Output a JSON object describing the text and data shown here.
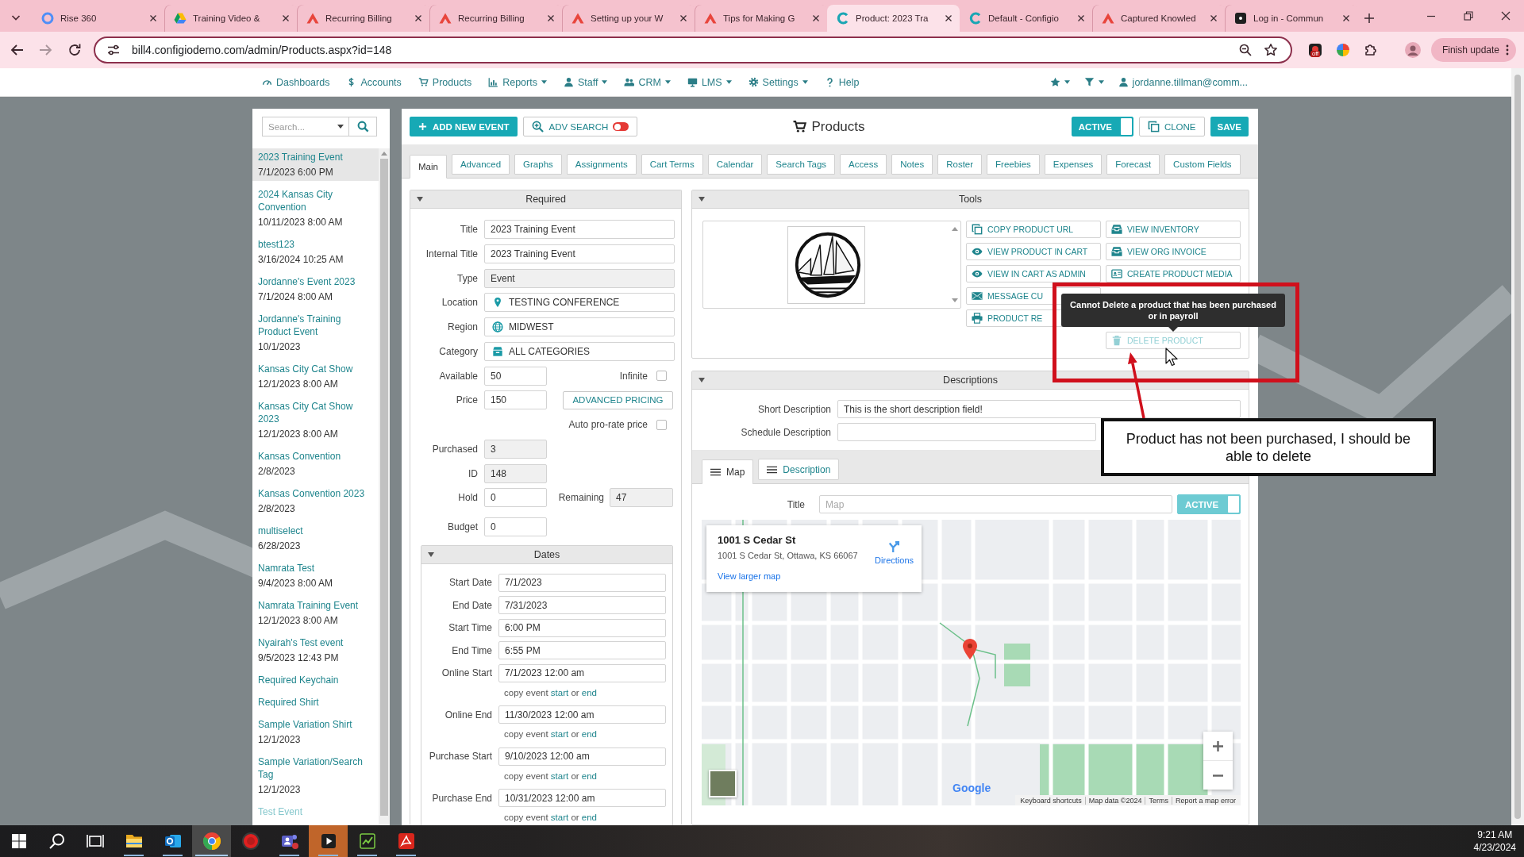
{
  "browser": {
    "tabs": [
      {
        "title": "Rise 360",
        "selected": false
      },
      {
        "title": "Training Video &",
        "selected": false
      },
      {
        "title": "Recurring Billing",
        "selected": false
      },
      {
        "title": "Recurring Billing",
        "selected": false
      },
      {
        "title": "Setting up your W",
        "selected": false
      },
      {
        "title": "Tips for Making G",
        "selected": false
      },
      {
        "title": "Product: 2023 Tra",
        "selected": true
      },
      {
        "title": "Default - Configio",
        "selected": false
      },
      {
        "title": "Captured Knowled",
        "selected": false
      },
      {
        "title": "Log in - Commun",
        "selected": false
      }
    ],
    "url": "bill4.configiodemo.com/admin/Products.aspx?id=148",
    "extension_badge": "off",
    "update_button": "Finish update"
  },
  "nav": {
    "items": [
      {
        "label": "Dashboards",
        "dropdown": false
      },
      {
        "label": "Accounts",
        "dropdown": false
      },
      {
        "label": "Products",
        "dropdown": false
      },
      {
        "label": "Reports",
        "dropdown": true
      },
      {
        "label": "Staff",
        "dropdown": true
      },
      {
        "label": "CRM",
        "dropdown": true
      },
      {
        "label": "LMS",
        "dropdown": true
      },
      {
        "label": "Settings",
        "dropdown": true
      },
      {
        "label": "Help",
        "dropdown": false
      }
    ],
    "user": "jordanne.tillman@comm..."
  },
  "sidebar": {
    "search_placeholder": "Search...",
    "items": [
      {
        "name": "2023 Training Event",
        "date": "7/1/2023 6:00 PM",
        "selected": true,
        "inactive": false
      },
      {
        "name": "2024 Kansas City Convention",
        "date": "10/11/2023 8:00 AM",
        "selected": false,
        "inactive": false
      },
      {
        "name": "btest123",
        "date": "3/16/2024 10:25 AM",
        "selected": false,
        "inactive": false
      },
      {
        "name": "Jordanne's Event 2023",
        "date": "7/1/2024 8:00 AM",
        "selected": false,
        "inactive": false
      },
      {
        "name": "Jordanne's Training Product Event",
        "date": "10/1/2023",
        "selected": false,
        "inactive": false
      },
      {
        "name": "Kansas City Cat Show",
        "date": "12/1/2023 8:00 AM",
        "selected": false,
        "inactive": false
      },
      {
        "name": "Kansas City Cat Show 2023",
        "date": "12/1/2023 8:00 AM",
        "selected": false,
        "inactive": false
      },
      {
        "name": "Kansas Convention",
        "date": "2/8/2023",
        "selected": false,
        "inactive": false
      },
      {
        "name": "Kansas Convention 2023",
        "date": "2/8/2023",
        "selected": false,
        "inactive": false
      },
      {
        "name": "multiselect",
        "date": "6/28/2023",
        "selected": false,
        "inactive": false
      },
      {
        "name": "Namrata Test",
        "date": "9/4/2023 8:00 AM",
        "selected": false,
        "inactive": false
      },
      {
        "name": "Namrata Training Event",
        "date": "12/1/2023 8:00 AM",
        "selected": false,
        "inactive": false
      },
      {
        "name": "Nyairah's Test event",
        "date": "9/5/2023 12:43 PM",
        "selected": false,
        "inactive": false
      },
      {
        "name": "Required Keychain",
        "selected": false,
        "inactive": false
      },
      {
        "name": "Required Shirt",
        "selected": false,
        "inactive": false
      },
      {
        "name": "Sample Variation Shirt",
        "date": "12/1/2023",
        "selected": false,
        "inactive": false
      },
      {
        "name": "Sample Variation/Search Tag",
        "date": "12/1/2023",
        "selected": false,
        "inactive": false
      },
      {
        "name": "Test Event",
        "selected": false,
        "inactive": true
      }
    ]
  },
  "toolbar": {
    "add_button": "ADD NEW EVENT",
    "adv_search": {
      "label": "ADV SEARCH",
      "on": false
    },
    "title": "Products",
    "active": {
      "label": "ACTIVE",
      "on": true
    },
    "clone_button": "CLONE",
    "save_button": "SAVE"
  },
  "tabs": [
    {
      "label": "Main",
      "selected": true
    },
    {
      "label": "Advanced",
      "selected": false
    },
    {
      "label": "Graphs",
      "selected": false
    },
    {
      "label": "Assignments",
      "selected": false
    },
    {
      "label": "Cart Terms",
      "selected": false
    },
    {
      "label": "Calendar",
      "selected": false
    },
    {
      "label": "Search Tags",
      "selected": false
    },
    {
      "label": "Access",
      "selected": false
    },
    {
      "label": "Notes",
      "selected": false
    },
    {
      "label": "Roster",
      "selected": false
    },
    {
      "label": "Freebies",
      "selected": false
    },
    {
      "label": "Expenses",
      "selected": false
    },
    {
      "label": "Forecast",
      "selected": false
    },
    {
      "label": "Custom Fields",
      "selected": false
    }
  ],
  "required": {
    "heading": "Required",
    "rows": [
      {
        "kind": "text",
        "label": "Title",
        "value": "2023 Training Event",
        "readonly": false
      },
      {
        "kind": "text",
        "label": "Internal Title",
        "value": "2023 Training Event",
        "readonly": false
      },
      {
        "kind": "text",
        "label": "Type",
        "value": "Event",
        "readonly": true
      },
      {
        "kind": "picker",
        "label": "Location",
        "value": "TESTING CONFERENCE"
      },
      {
        "kind": "picker",
        "label": "Region",
        "value": "MIDWEST"
      },
      {
        "kind": "picker",
        "label": "Category",
        "value": "ALL CATEGORIES"
      },
      {
        "kind": "number",
        "label": "Available",
        "value": "50",
        "readonly": false,
        "aside": {
          "kind": "checkbox",
          "label": "Infinite",
          "checked": false
        }
      },
      {
        "kind": "number",
        "label": "Price",
        "value": "150",
        "readonly": false,
        "aside": {
          "kind": "button",
          "label": "ADVANCED PRICING"
        }
      },
      {
        "kind": "check",
        "label": "Auto pro-rate price",
        "checked": false
      },
      {
        "kind": "number",
        "label": "Purchased",
        "value": "3",
        "readonly": true
      },
      {
        "kind": "number",
        "label": "ID",
        "value": "148",
        "readonly": true
      },
      {
        "kind": "number",
        "label": "Hold",
        "value": "0",
        "readonly": false,
        "aside": {
          "kind": "field",
          "label": "Remaining",
          "value": "47",
          "readonly": true
        }
      },
      {
        "kind": "number",
        "label": "Budget",
        "value": "0",
        "readonly": false
      }
    ],
    "dates": {
      "heading": "Dates",
      "rows": [
        {
          "label": "Start Date",
          "value": "7/1/2023"
        },
        {
          "label": "End Date",
          "value": "7/31/2023"
        },
        {
          "label": "Start Time",
          "value": "6:00 PM"
        },
        {
          "label": "End Time",
          "value": "6:55 PM"
        },
        {
          "label": "Online Start",
          "value": "7/1/2023 12:00 am",
          "copy": {
            "lead": "copy event",
            "start": "start",
            "joiner": "or",
            "end": "end"
          }
        },
        {
          "label": "Online End",
          "value": "11/30/2023 12:00 am",
          "copy": {
            "lead": "copy event",
            "start": "start",
            "joiner": "or",
            "end": "end"
          }
        },
        {
          "label": "Purchase Start",
          "value": "9/10/2023 12:00 am",
          "copy": {
            "lead": "copy event",
            "start": "start",
            "joiner": "or",
            "end": "end"
          }
        },
        {
          "label": "Purchase End",
          "value": "10/31/2023 12:00 am",
          "copy": {
            "lead": "copy event",
            "start": "start",
            "joiner": "or",
            "end": "end"
          }
        }
      ]
    }
  },
  "tools": {
    "heading": "Tools",
    "left_buttons": [
      {
        "label": "COPY PRODUCT URL",
        "disabled": false
      },
      {
        "label": "VIEW PRODUCT IN CART",
        "disabled": false
      },
      {
        "label": "VIEW IN CART AS ADMIN",
        "disabled": false
      },
      {
        "label": "MESSAGE CU",
        "disabled": false
      },
      {
        "label": "PRODUCT RE",
        "disabled": false
      }
    ],
    "right_buttons": [
      {
        "label": "VIEW INVENTORY",
        "disabled": false
      },
      {
        "label": "VIEW ORG INVOICE",
        "disabled": false
      },
      {
        "label": "CREATE PRODUCT MEDIA",
        "disabled": false
      },
      {
        "label": "DELETE PRODUCT",
        "disabled": true
      }
    ],
    "tooltip": "Cannot Delete a product that has been purchased or in payroll"
  },
  "descriptions": {
    "heading": "Descriptions",
    "fields": [
      {
        "label": "Short Description",
        "value": "This is the short description field!"
      },
      {
        "label": "Schedule Description"
      }
    ],
    "tabs": [
      {
        "label": "Map",
        "selected": true
      },
      {
        "label": "Description",
        "selected": false
      }
    ],
    "map": {
      "title_field": {
        "label": "Title",
        "placeholder": "Map"
      },
      "active": {
        "label": "ACTIVE",
        "on": true,
        "disabled": true
      },
      "info_card": {
        "name": "1001 S Cedar St",
        "address": "1001 S Cedar St, Ottawa, KS 66067",
        "directions": "Directions",
        "larger_map": "View larger map"
      },
      "logo": "Google",
      "attribution": [
        "Keyboard shortcuts",
        "Map data ©2024",
        "Terms",
        "Report a map error"
      ]
    }
  },
  "annotation": {
    "callout": "Product has not been purchased, I should be able to delete"
  },
  "taskbar": {
    "apps": [
      {
        "selected": false,
        "running": true,
        "flashing": false
      },
      {
        "selected": false,
        "running": true,
        "flashing": false
      },
      {
        "selected": true,
        "running": true,
        "flashing": false
      },
      {
        "selected": false,
        "running": false,
        "flashing": false
      },
      {
        "selected": false,
        "running": true,
        "flashing": false
      },
      {
        "selected": false,
        "running": true,
        "flashing": true
      },
      {
        "selected": false,
        "running": true,
        "flashing": false
      },
      {
        "selected": false,
        "running": true,
        "flashing": false
      }
    ],
    "time": "9:21 AM",
    "date": "4/23/2024"
  }
}
